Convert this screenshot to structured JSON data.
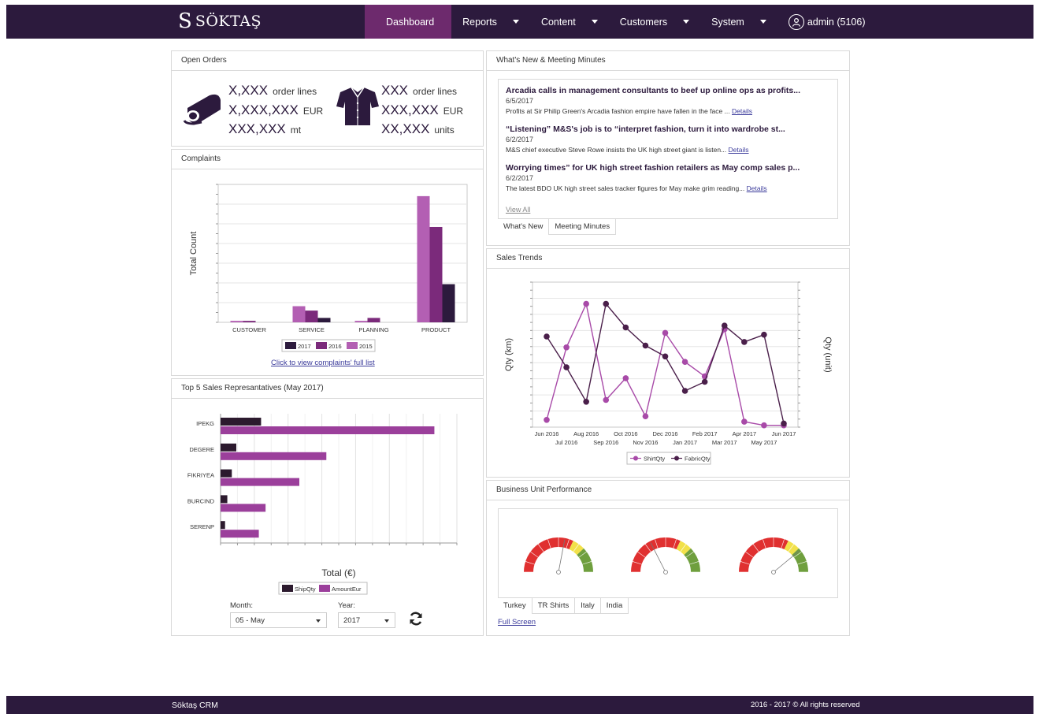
{
  "brand": {
    "mark": "S",
    "name": "SÖKTAŞ"
  },
  "nav": {
    "dashboard": "Dashboard",
    "reports": "Reports",
    "content": "Content",
    "customers": "Customers",
    "system": "System",
    "user": "admin (5106)"
  },
  "open_orders": {
    "title": "Open Orders",
    "fabric": {
      "order_lines": "X,XXX",
      "order_lines_unit": "order lines",
      "amount": "X,XXX,XXX",
      "amount_unit": "EUR",
      "qty": "XXX,XXX",
      "qty_unit": "mt"
    },
    "shirts": {
      "order_lines": "XXX",
      "order_lines_unit": "order lines",
      "amount": "XXX,XXX",
      "amount_unit": "EUR",
      "qty": "XX,XXX",
      "qty_unit": "units"
    }
  },
  "complaints": {
    "title": "Complaints",
    "link": "Click to view complaints' full list"
  },
  "top5": {
    "title": "Top 5 Sales Represantatives (May 2017)",
    "month_label": "Month:",
    "month_value": "05 - May",
    "year_label": "Year:",
    "year_value": "2017"
  },
  "news": {
    "title": "What's New & Meeting Minutes",
    "items": [
      {
        "title": "Arcadia calls in management consultants to beef up online ops as profits...",
        "date": "6/5/2017",
        "text": "Profits at Sir Philip Green's Arcadia fashion empire have fallen in the face ...",
        "link": "Details"
      },
      {
        "title": "“Listening” M&S's job is to “interpret fashion, turn it into wardrobe st...",
        "date": "6/2/2017",
        "text": "M&S chief executive Steve Rowe insists the UK high street giant is listen...",
        "link": "Details"
      },
      {
        "title": "Worrying times” for UK high street fashion retailers as May comp sales p...",
        "date": "6/2/2017",
        "text": "The latest BDO UK high street sales tracker figures for May make grim reading...",
        "link": "Details"
      }
    ],
    "view_all": "View All",
    "tabs": [
      "What's New",
      "Meeting Minutes"
    ]
  },
  "sales_trends": {
    "title": "Sales Trends"
  },
  "bu": {
    "title": "Business Unit Performance",
    "tabs": [
      "Turkey",
      "TR Shirts",
      "Italy",
      "India"
    ],
    "fullscreen": "Full Screen",
    "gauge_labels": [
      "",
      "",
      ""
    ],
    "gauge_values": [
      0.56,
      0.35,
      0.78
    ]
  },
  "footer": {
    "left": "Söktaş CRM",
    "right": "2016 - 2017 © All rights reserved"
  },
  "colors": {
    "dark": "#2c1a3d",
    "accent": "#6d2a6d",
    "c2017": "#2c1a3d",
    "c2016": "#7b2a7b",
    "c2015": "#b35fb3",
    "ship": "#2c1a2e",
    "amount": "#9b3f9b"
  },
  "chart_data": [
    {
      "type": "bar",
      "ylabel": "Total Count",
      "categories": [
        "CUSTOMER",
        "SERVICE",
        "PLANNING",
        "PRODUCT"
      ],
      "series": [
        {
          "name": "2017",
          "values": [
            0,
            3,
            0,
            26
          ]
        },
        {
          "name": "2016",
          "values": [
            1,
            8,
            3,
            65
          ]
        },
        {
          "name": "2015",
          "values": [
            1,
            11,
            1,
            86
          ]
        }
      ],
      "ylim": [
        0,
        94
      ],
      "legend": "bottom"
    },
    {
      "type": "bar",
      "orientation": "horizontal",
      "xlabel": "Total (€)",
      "categories": [
        "IPEKG",
        "DEGERE",
        "FIKRIYEA",
        "BURCIND",
        "SERENP"
      ],
      "series": [
        {
          "name": "ShipQty",
          "values": [
            18,
            7,
            5,
            3,
            2
          ]
        },
        {
          "name": "AmountEur",
          "values": [
            95,
            47,
            35,
            20,
            17
          ]
        }
      ],
      "xlim": [
        0,
        105
      ],
      "legend": "bottom"
    },
    {
      "type": "line",
      "ylabel": "Qty (km)",
      "ylabel_right": "Qty (unit)",
      "x": [
        "Jun 2016",
        "Jul 2016",
        "Aug 2016",
        "Sep 2016",
        "Oct 2016",
        "Nov 2016",
        "Dec 2016",
        "Jan 2017",
        "Feb 2017",
        "Mar 2017",
        "Apr 2017",
        "May 2017",
        "Jun 2017"
      ],
      "series": [
        {
          "name": "ShirtQty",
          "values": [
            4,
            44,
            68,
            15,
            27,
            6,
            52,
            36,
            28,
            54,
            3,
            1,
            1
          ]
        },
        {
          "name": "FabricQty",
          "values": [
            50,
            33,
            14,
            68,
            55,
            45,
            39,
            20,
            25,
            56,
            47,
            51,
            2
          ]
        }
      ],
      "ylim": [
        0,
        80
      ],
      "legend": "bottom"
    }
  ]
}
